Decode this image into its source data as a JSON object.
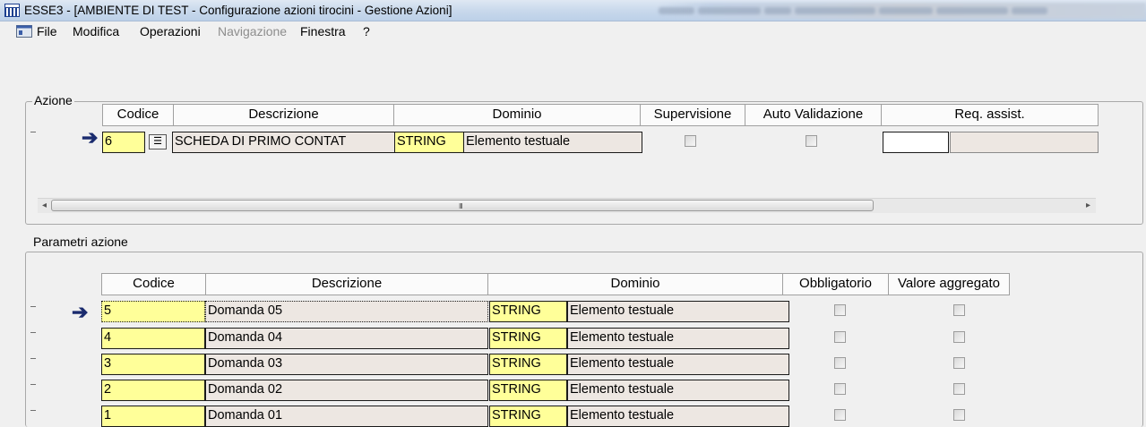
{
  "window": {
    "title": "ESSE3 - [AMBIENTE DI TEST - Configurazione azioni tirocini - Gestione Azioni]",
    "icon": "esse3-app-icon"
  },
  "menu": {
    "items": [
      {
        "label": "File",
        "enabled": true
      },
      {
        "label": "Modifica",
        "enabled": true
      },
      {
        "label": "Operazioni",
        "enabled": true
      },
      {
        "label": "Navigazione",
        "enabled": false
      },
      {
        "label": "Finestra",
        "enabled": true
      },
      {
        "label": "?",
        "enabled": true
      }
    ]
  },
  "azione": {
    "group_label": "Azione",
    "columns": [
      "Codice",
      "Descrizione",
      "Dominio",
      "Supervisione",
      "Auto Validazione",
      "Req. assist."
    ],
    "row": {
      "codice": "6",
      "descrizione": "SCHEDA DI PRIMO CONTAT",
      "dominio_code": "STRING",
      "dominio_desc": "Elemento testuale",
      "supervisione": false,
      "auto_validazione": false,
      "req_assist_value": "",
      "req_assist_desc": ""
    },
    "scrollbar_grip": "III"
  },
  "parametri": {
    "group_label": "Parametri azione",
    "columns": [
      "Codice",
      "Descrizione",
      "Dominio",
      "Obbligatorio",
      "Valore aggregato"
    ],
    "rows": [
      {
        "codice": "5",
        "descrizione": "Domanda 05",
        "dominio_code": "STRING",
        "dominio_desc": "Elemento testuale",
        "obbligatorio": false,
        "valore_aggregato": false
      },
      {
        "codice": "4",
        "descrizione": "Domanda 04",
        "dominio_code": "STRING",
        "dominio_desc": "Elemento testuale",
        "obbligatorio": false,
        "valore_aggregato": false
      },
      {
        "codice": "3",
        "descrizione": "Domanda 03",
        "dominio_code": "STRING",
        "dominio_desc": "Elemento testuale",
        "obbligatorio": false,
        "valore_aggregato": false
      },
      {
        "codice": "2",
        "descrizione": "Domanda 02",
        "dominio_code": "STRING",
        "dominio_desc": "Elemento testuale",
        "obbligatorio": false,
        "valore_aggregato": false
      },
      {
        "codice": "1",
        "descrizione": "Domanda 01",
        "dominio_code": "STRING",
        "dominio_desc": "Elemento testuale",
        "obbligatorio": false,
        "valore_aggregato": false
      }
    ]
  },
  "colors": {
    "key_field": "#ffff99",
    "readonly_field": "#ede7e2",
    "current_row_arrow": "#1a2b6e"
  }
}
